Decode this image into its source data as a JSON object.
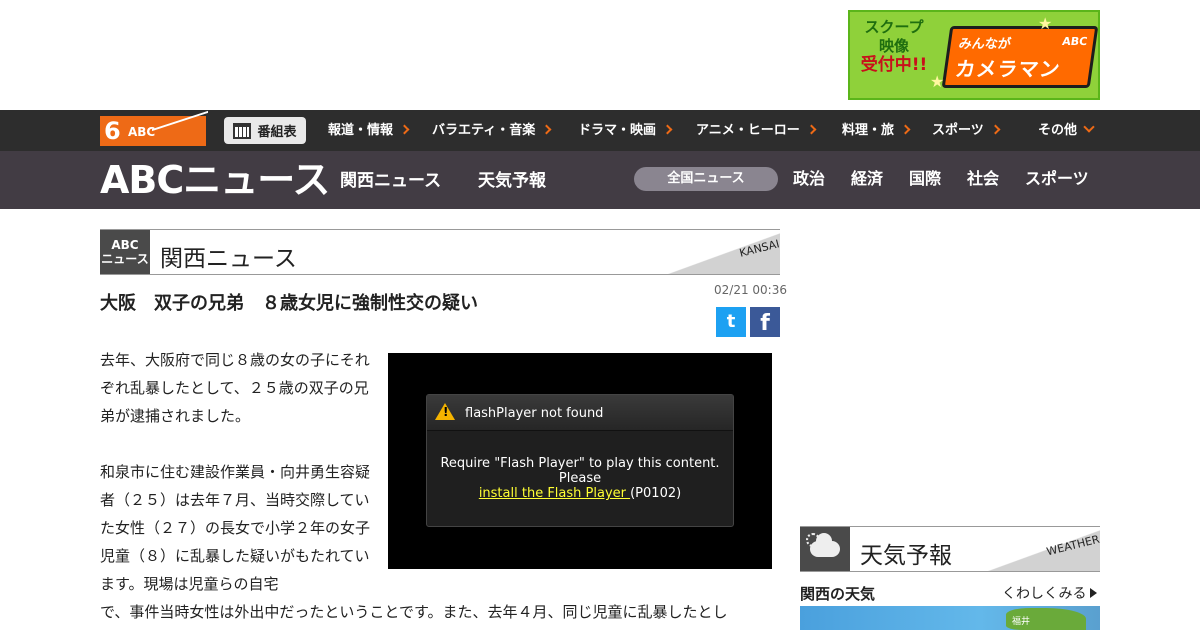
{
  "banner": {
    "line1": "スクープ",
    "line2": "映像",
    "line3": "受付中!!",
    "title_top": "みんなが",
    "title_main": "カメラマン",
    "abc": "ABC"
  },
  "channel_logo": {
    "six": "6",
    "abc": "ABC"
  },
  "bangumi_label": "番組表",
  "channel_nav": [
    {
      "label": "報道・情報"
    },
    {
      "label": "バラエティ・音楽"
    },
    {
      "label": "ドラマ・映画"
    },
    {
      "label": "アニメ・ヒーロー"
    },
    {
      "label": "料理・旅"
    },
    {
      "label": "スポーツ"
    }
  ],
  "channel_more": "その他",
  "news_logo": "ABCニュース",
  "news_nav": {
    "kansai": "関西ニュース",
    "weather": "天気予報"
  },
  "categories": {
    "active": "全国ニュース",
    "items": [
      "政治",
      "経済",
      "国際",
      "社会",
      "スポーツ"
    ]
  },
  "section": {
    "badge_line1": "ABC",
    "badge_line2": "ニュース",
    "title": "関西ニュース",
    "tag": "KANSAI"
  },
  "article": {
    "headline": "大阪　双子の兄弟　８歳女児に強制性交の疑い",
    "timestamp": "02/21 00:36",
    "para1": "去年、大阪府で同じ８歳の女の子にそれぞれ乱暴したとして、２５歳の双子の兄弟が逮捕されました。",
    "para2": "和泉市に住む建設作業員・向井勇生容疑者（２５）は去年７月、当時交際していた女性（２７）の長女で小学２年の女子児童（８）に乱暴した疑いがもたれています。現場は児童らの自宅",
    "para3": "で、事件当時女性は外出中だったということです。また、去年４月、同じ児童に乱暴したとし"
  },
  "share": {
    "twitter": "twitter-icon",
    "facebook": "facebook-icon"
  },
  "video": {
    "error_title": "flashPlayer not found",
    "msg1": "Require \"Flash Player\" to play this content.",
    "msg2": "Please",
    "link": "install the Flash Player ",
    "code": "(P0102)"
  },
  "weather": {
    "title": "天気予報",
    "tag": "WEATHER",
    "region": "関西の天気",
    "more": "くわしくみる",
    "map_label": "福井"
  },
  "colors": {
    "accent": "#ee6a16",
    "nav_dark": "#2d2d2d",
    "news_bar": "#423c44",
    "link_yellow": "#ffff33"
  }
}
